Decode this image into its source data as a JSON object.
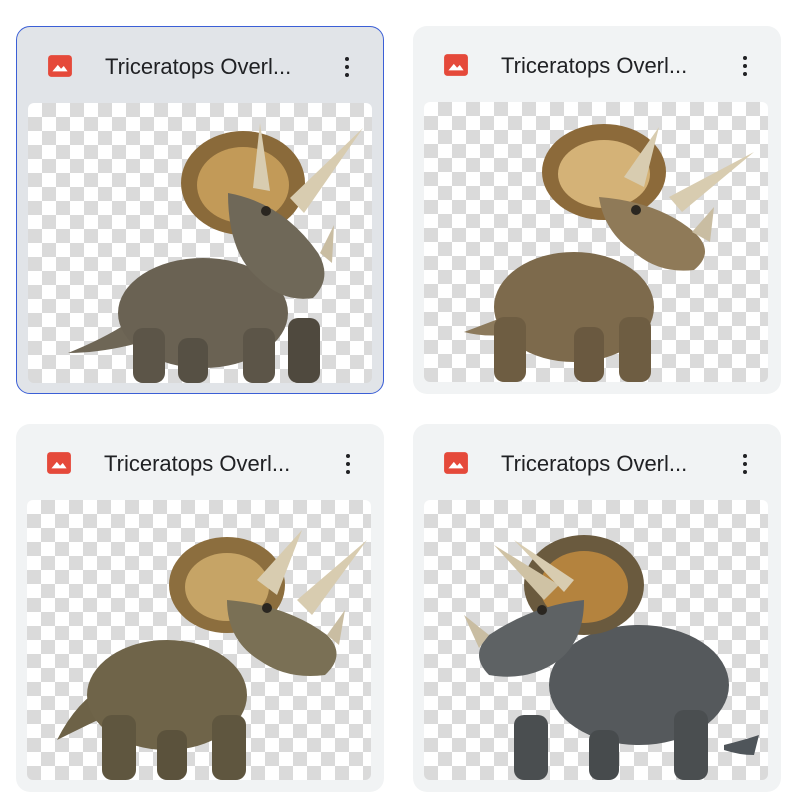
{
  "files": [
    {
      "title": "Triceratops Overl...",
      "icon": "image-file-icon",
      "menu_icon": "more-vert-icon",
      "selected": true,
      "theme": "grey-brown"
    },
    {
      "title": "Triceratops Overl...",
      "icon": "image-file-icon",
      "menu_icon": "more-vert-icon",
      "selected": false,
      "theme": "tan"
    },
    {
      "title": "Triceratops Overl...",
      "icon": "image-file-icon",
      "menu_icon": "more-vert-icon",
      "selected": false,
      "theme": "olive"
    },
    {
      "title": "Triceratops Overl...",
      "icon": "image-file-icon",
      "menu_icon": "more-vert-icon",
      "selected": false,
      "theme": "slate"
    }
  ],
  "colors": {
    "accent_selected_border": "#3b5fd6",
    "card_bg": "#f1f3f4",
    "card_selected_bg": "#e1e4e8",
    "file_icon_red": "#e5493a",
    "text": "#202124"
  }
}
